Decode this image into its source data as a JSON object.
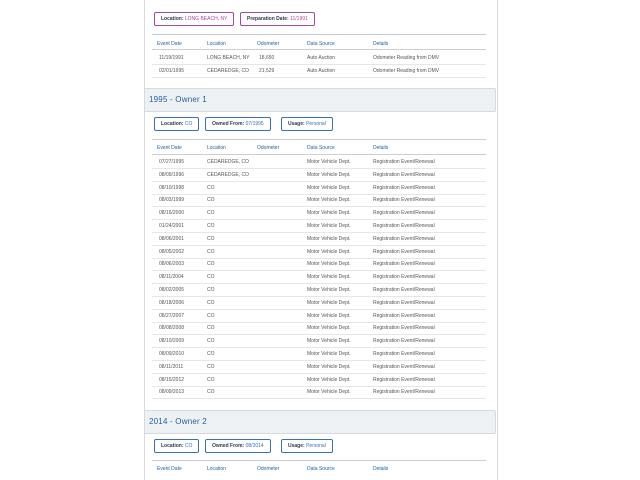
{
  "columns": [
    "Event Date",
    "Location",
    "Odometer",
    "Data Source",
    "Details"
  ],
  "top_section": {
    "pills": [
      {
        "label": "Location:",
        "value": "LONG BEACH, NY"
      },
      {
        "label": "Preparation Date:",
        "value": "11/1991"
      }
    ],
    "rows": [
      {
        "date": "11/19/1991",
        "location": "LONG BEACH, NY",
        "odometer": "18,650",
        "source": "Auto Auction",
        "details": "Odometer Reading from DMV"
      },
      {
        "date": "02/01/1995",
        "location": "CEDAREDGE, CO",
        "odometer": "21,529",
        "source": "Auto Auction",
        "details": "Odometer Reading from DMV"
      }
    ]
  },
  "owner1": {
    "title": "1995 - Owner   1",
    "pills": [
      {
        "label": "Location:",
        "value": "CO"
      },
      {
        "label": "Owned From:",
        "value": "07/1995"
      },
      {
        "label": "Usage:",
        "value": "Personal"
      }
    ],
    "rows": [
      {
        "date": "07/27/1995",
        "location": "CEDAREDGE, CO",
        "source": "Motor Vehicle Dept.",
        "details": "Registration Event/Renewal"
      },
      {
        "date": "08/09/1996",
        "location": "CEDAREDGE, CO",
        "source": "Motor Vehicle Dept.",
        "details": "Registration Event/Renewal"
      },
      {
        "date": "08/10/1998",
        "location": "CO",
        "source": "Motor Vehicle Dept.",
        "details": "Registration Event/Renewal"
      },
      {
        "date": "08/03/1999",
        "location": "CO",
        "source": "Motor Vehicle Dept.",
        "details": "Registration Event/Renewal"
      },
      {
        "date": "08/16/2000",
        "location": "CO",
        "source": "Motor Vehicle Dept.",
        "details": "Registration Event/Renewal"
      },
      {
        "date": "01/24/2001",
        "location": "CO",
        "source": "Motor Vehicle Dept.",
        "details": "Registration Event/Renewal"
      },
      {
        "date": "08/06/2001",
        "location": "CO",
        "source": "Motor Vehicle Dept.",
        "details": "Registration Event/Renewal"
      },
      {
        "date": "08/05/2002",
        "location": "CO",
        "source": "Motor Vehicle Dept.",
        "details": "Registration Event/Renewal"
      },
      {
        "date": "08/06/2003",
        "location": "CO",
        "source": "Motor Vehicle Dept.",
        "details": "Registration Event/Renewal"
      },
      {
        "date": "08/11/2004",
        "location": "CO",
        "source": "Motor Vehicle Dept.",
        "details": "Registration Event/Renewal"
      },
      {
        "date": "08/02/2005",
        "location": "CO",
        "source": "Motor Vehicle Dept.",
        "details": "Registration Event/Renewal"
      },
      {
        "date": "08/18/2006",
        "location": "CO",
        "source": "Motor Vehicle Dept.",
        "details": "Registration Event/Renewal"
      },
      {
        "date": "08/27/2007",
        "location": "CO",
        "source": "Motor Vehicle Dept.",
        "details": "Registration Event/Renewal"
      },
      {
        "date": "08/08/2008",
        "location": "CO",
        "source": "Motor Vehicle Dept.",
        "details": "Registration Event/Renewal"
      },
      {
        "date": "08/10/2009",
        "location": "CO",
        "source": "Motor Vehicle Dept.",
        "details": "Registration Event/Renewal"
      },
      {
        "date": "08/09/2010",
        "location": "CO",
        "source": "Motor Vehicle Dept.",
        "details": "Registration Event/Renewal"
      },
      {
        "date": "08/11/2011",
        "location": "CO",
        "source": "Motor Vehicle Dept.",
        "details": "Registration Event/Renewal"
      },
      {
        "date": "08/15/2012",
        "location": "CO",
        "source": "Motor Vehicle Dept.",
        "details": "Registration Event/Renewal"
      },
      {
        "date": "08/09/2013",
        "location": "CO",
        "source": "Motor Vehicle Dept.",
        "details": "Registration Event/Renewal"
      }
    ]
  },
  "owner2": {
    "title": "2014 - Owner   2",
    "pills": [
      {
        "label": "Location:",
        "value": "CO"
      },
      {
        "label": "Owned From:",
        "value": "08/2014"
      },
      {
        "label": "Usage:",
        "value": "Personal"
      }
    ]
  }
}
